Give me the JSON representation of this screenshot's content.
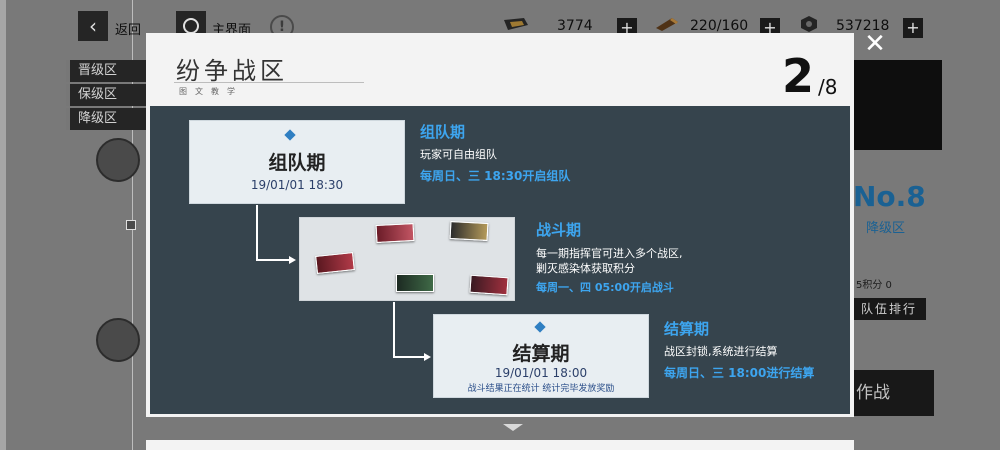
{
  "topbar": {
    "back_label": "返回",
    "home_label": "主界面",
    "info_glyph": "!",
    "resources": [
      {
        "icon": "ticket-icon",
        "value": "3774"
      },
      {
        "icon": "ammo-icon",
        "value": "220/160"
      },
      {
        "icon": "coin-icon",
        "value": "537218"
      }
    ],
    "plus_glyph": "+"
  },
  "sidebar": {
    "tabs": [
      {
        "label": "晋级区"
      },
      {
        "label": "保级区"
      },
      {
        "label": "降级区"
      }
    ]
  },
  "right_panel": {
    "rank": "No.8",
    "zone": "降级区",
    "score_text": "5积分 0",
    "team_rank_button": "队伍排行",
    "battle_button": "作战"
  },
  "modal": {
    "title": "纷争战区",
    "subtitle": "图文教学",
    "page_current": "2",
    "page_total": "/8",
    "close_glyph": "✕"
  },
  "phases": {
    "team": {
      "card_title": "组队期",
      "card_date": "19/01/01  18:30",
      "title": "组队期",
      "desc": [
        "玩家可自由组队"
      ],
      "time": "每周日、三 18:30开启组队"
    },
    "battle": {
      "title": "战斗期",
      "desc": [
        "每一期指挥官可进入多个战区,",
        "剿灭感染体获取积分"
      ],
      "time": "每周一、四 05:00开启战斗"
    },
    "settle": {
      "card_title": "结算期",
      "card_date": "19/01/01  18:00",
      "card_note": "战斗结果正在统计  统计完毕发放奖励",
      "title": "结算期",
      "desc": [
        "战区封锁,系统进行结算"
      ],
      "time": "每周日、三 18:00进行结算"
    }
  },
  "colors": {
    "accent_blue": "#3da5ef",
    "slide_bg": "#36444d",
    "rank_blue": "#1e6fa8"
  }
}
